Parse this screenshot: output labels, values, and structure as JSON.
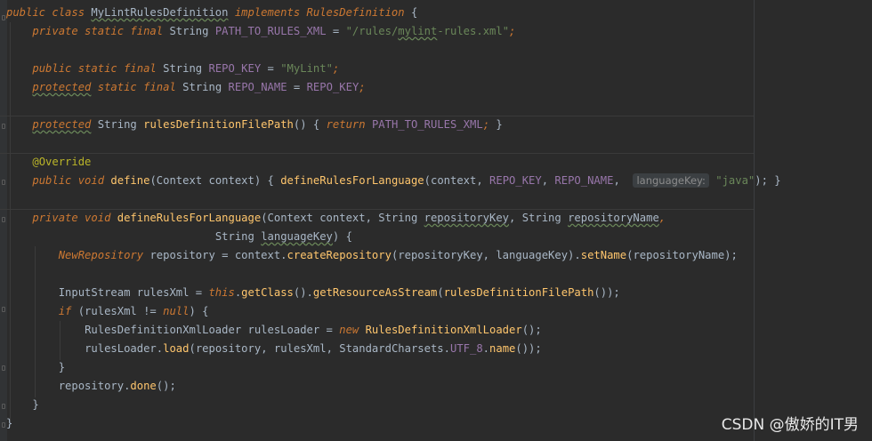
{
  "watermark": "CSDN @傲娇的IT男",
  "colors": {
    "background": "#2b2b2b",
    "keyword": "#cc7832",
    "text": "#a9b7c6",
    "string": "#6a8759",
    "method": "#ffc66d",
    "constant": "#9876aa",
    "annotation": "#bbb529",
    "hint_bg": "#3b3f42"
  },
  "code_lines": [
    [
      {
        "t": "public class ",
        "c": "kw"
      },
      {
        "t": "MyLintRulesDefinition",
        "c": "tx",
        "u": true
      },
      {
        "t": " implements ",
        "c": "kw"
      },
      {
        "t": "RulesDefinition",
        "c": "if"
      },
      {
        "t": " {",
        "c": "tx"
      }
    ],
    [
      {
        "t": "    "
      },
      {
        "t": "private static final ",
        "c": "kw"
      },
      {
        "t": "String ",
        "c": "tx"
      },
      {
        "t": "PATH_TO_RULES_XML",
        "c": "cn"
      },
      {
        "t": " = ",
        "c": "tx"
      },
      {
        "t": "\"/rules/",
        "c": "st"
      },
      {
        "t": "mylint",
        "c": "st",
        "u": true
      },
      {
        "t": "-rules.xml\"",
        "c": "st"
      },
      {
        "t": ";",
        "c": "kw"
      }
    ],
    [],
    [
      {
        "t": "    "
      },
      {
        "t": "public static final ",
        "c": "kw"
      },
      {
        "t": "String ",
        "c": "tx"
      },
      {
        "t": "REPO_KEY",
        "c": "cn"
      },
      {
        "t": " = ",
        "c": "tx"
      },
      {
        "t": "\"MyLint\"",
        "c": "st"
      },
      {
        "t": ";",
        "c": "kw"
      }
    ],
    [
      {
        "t": "    "
      },
      {
        "t": "protected",
        "c": "kw",
        "u": true
      },
      {
        "t": " static final ",
        "c": "kw"
      },
      {
        "t": "String ",
        "c": "tx"
      },
      {
        "t": "REPO_NAME",
        "c": "cn"
      },
      {
        "t": " = ",
        "c": "tx"
      },
      {
        "t": "REPO_KEY",
        "c": "cn"
      },
      {
        "t": ";",
        "c": "kw"
      }
    ],
    [],
    [
      {
        "t": "    "
      },
      {
        "t": "protected",
        "c": "kw",
        "u": true
      },
      {
        "t": " String ",
        "c": "tx"
      },
      {
        "t": "rulesDefinitionFilePath",
        "c": "md"
      },
      {
        "t": "() { ",
        "c": "tx"
      },
      {
        "t": "return ",
        "c": "kw"
      },
      {
        "t": "PATH_TO_RULES_XML",
        "c": "cn"
      },
      {
        "t": "; ",
        "c": "kw"
      },
      {
        "t": "}",
        "c": "tx"
      }
    ],
    [],
    [
      {
        "t": "    "
      },
      {
        "t": "@Override",
        "c": "an"
      }
    ],
    [
      {
        "t": "    "
      },
      {
        "t": "public void ",
        "c": "kw"
      },
      {
        "t": "define",
        "c": "md"
      },
      {
        "t": "(Context context) { ",
        "c": "tx"
      },
      {
        "t": "defineRulesForLanguage",
        "c": "md"
      },
      {
        "t": "(context, ",
        "c": "tx"
      },
      {
        "t": "REPO_KEY",
        "c": "cn"
      },
      {
        "t": ", ",
        "c": "tx"
      },
      {
        "t": "REPO_NAME",
        "c": "cn"
      },
      {
        "t": ",  ",
        "c": "tx"
      },
      {
        "t": "languageKey:",
        "c": "hint"
      },
      {
        "t": " ",
        "c": "tx"
      },
      {
        "t": "\"java\"",
        "c": "st"
      },
      {
        "t": "); }",
        "c": "tx"
      }
    ],
    [],
    [
      {
        "t": "    "
      },
      {
        "t": "private void ",
        "c": "kw"
      },
      {
        "t": "defineRulesForLanguage",
        "c": "md"
      },
      {
        "t": "(Context context, String ",
        "c": "tx"
      },
      {
        "t": "repositoryKey",
        "c": "tx",
        "u": true
      },
      {
        "t": ", String ",
        "c": "tx"
      },
      {
        "t": "repositoryName",
        "c": "tx",
        "u": true
      },
      {
        "t": ",",
        "c": "kw"
      }
    ],
    [
      {
        "t": "                                "
      },
      {
        "t": "String ",
        "c": "tx"
      },
      {
        "t": "languageKey",
        "c": "tx",
        "u": true
      },
      {
        "t": ") {",
        "c": "tx"
      }
    ],
    [
      {
        "t": "        "
      },
      {
        "t": "NewRepository ",
        "c": "if"
      },
      {
        "t": "repository = context.",
        "c": "tx"
      },
      {
        "t": "createRepository",
        "c": "md"
      },
      {
        "t": "(repositoryKey, languageKey).",
        "c": "tx"
      },
      {
        "t": "setName",
        "c": "md"
      },
      {
        "t": "(repositoryName);",
        "c": "tx"
      }
    ],
    [],
    [
      {
        "t": "        "
      },
      {
        "t": "InputStream rulesXml = ",
        "c": "tx"
      },
      {
        "t": "this",
        "c": "kw"
      },
      {
        "t": ".",
        "c": "tx"
      },
      {
        "t": "getClass",
        "c": "md"
      },
      {
        "t": "().",
        "c": "tx"
      },
      {
        "t": "getResourceAsStream",
        "c": "md"
      },
      {
        "t": "(",
        "c": "tx"
      },
      {
        "t": "rulesDefinitionFilePath",
        "c": "md"
      },
      {
        "t": "());",
        "c": "tx"
      }
    ],
    [
      {
        "t": "        "
      },
      {
        "t": "if ",
        "c": "kw"
      },
      {
        "t": "(rulesXml != ",
        "c": "tx"
      },
      {
        "t": "null",
        "c": "kw"
      },
      {
        "t": ") {",
        "c": "tx"
      }
    ],
    [
      {
        "t": "            "
      },
      {
        "t": "RulesDefinitionXmlLoader rulesLoader = ",
        "c": "tx"
      },
      {
        "t": "new ",
        "c": "kw"
      },
      {
        "t": "RulesDefinitionXmlLoader",
        "c": "md"
      },
      {
        "t": "();",
        "c": "tx"
      }
    ],
    [
      {
        "t": "            "
      },
      {
        "t": "rulesLoader.",
        "c": "tx"
      },
      {
        "t": "load",
        "c": "md"
      },
      {
        "t": "(repository, rulesXml, StandardCharsets.",
        "c": "tx"
      },
      {
        "t": "UTF_8",
        "c": "cn"
      },
      {
        "t": ".",
        "c": "tx"
      },
      {
        "t": "name",
        "c": "md"
      },
      {
        "t": "());",
        "c": "tx"
      }
    ],
    [
      {
        "t": "        "
      },
      {
        "t": "}",
        "c": "tx"
      }
    ],
    [
      {
        "t": "        "
      },
      {
        "t": "repository.",
        "c": "tx"
      },
      {
        "t": "done",
        "c": "md"
      },
      {
        "t": "();",
        "c": "tx"
      }
    ],
    [
      {
        "t": "    "
      },
      {
        "t": "}",
        "c": "tx"
      }
    ],
    [
      {
        "t": "}",
        "c": "tx"
      }
    ]
  ]
}
